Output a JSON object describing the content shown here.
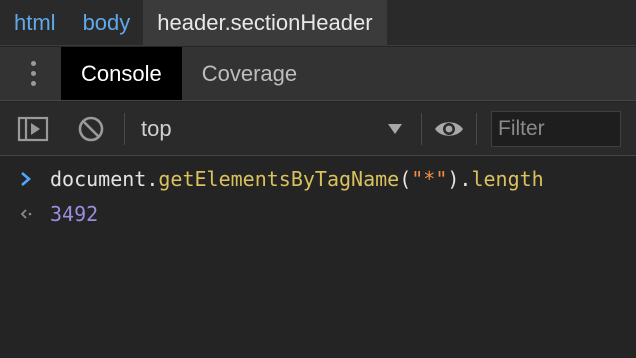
{
  "breadcrumb": {
    "items": [
      "html",
      "body",
      "header.sectionHeader"
    ]
  },
  "drawer": {
    "tabs": [
      "Console",
      "Coverage"
    ],
    "selected_tab": "Console",
    "menu_icon": "kebab-menu-icon"
  },
  "toolbar": {
    "sidebar_toggle_icon": "show-sidebar-icon",
    "clear_icon": "clear-console-icon",
    "context_value": "top",
    "context_dropdown_icon": "triangle-down-icon",
    "live_expression_icon": "eye-icon",
    "filter_placeholder": "Filter"
  },
  "console": {
    "input": {
      "prompt_icon": "chevron-right-icon",
      "object": "document",
      "dot1": ".",
      "method": "getElementsByTagName",
      "open_paren": "(",
      "argument": "\"*\"",
      "close_paren_dot": ").",
      "property": "length"
    },
    "output": {
      "result_icon": "return-arrow-icon",
      "value": "3492"
    }
  },
  "colors": {
    "link": "#5fa8ea",
    "function": "#d9c15e",
    "string": "#f08d49",
    "number": "#9a8ee0",
    "prompt": "#4ea6ff",
    "background": "#242424"
  }
}
